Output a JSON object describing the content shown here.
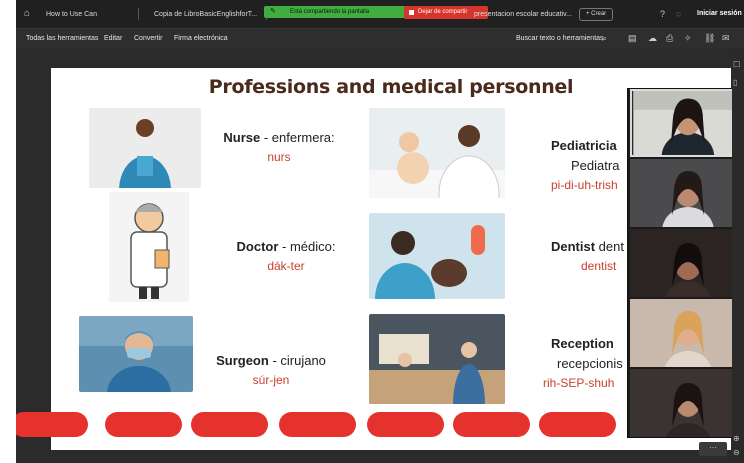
{
  "browser": {
    "tabs": [
      {
        "label": "How to Use Can"
      },
      {
        "label": "Copia de LibroBasicEnglishforT..."
      },
      {
        "label": "presentacion escolar educativ..."
      }
    ],
    "new_tab_label": "+ Crear",
    "sign_in": "Iniciar sesión",
    "share_banner": "Está compartiendo la pantalla",
    "stop_share": "Dejar de compartir"
  },
  "toolbar": {
    "items": [
      "Todas las herramientas",
      "Editar",
      "Convertir",
      "Firma electrónica"
    ],
    "search_label": "Buscar texto o herramientas"
  },
  "slide": {
    "title": "Professions and medical personnel",
    "cards": [
      {
        "term": "Nurse",
        "translation": " - enfermera:",
        "pron": "nurs",
        "picture": "nurse-photo"
      },
      {
        "term": "Doctor",
        "translation": " - médico:",
        "pron": "dák-ter",
        "picture": "doctor-cartoon"
      },
      {
        "term": "Surgeon",
        "translation": " - cirujano",
        "pron": "súr-jen",
        "picture": "surgeon-photo"
      },
      {
        "term": "Pediatricia",
        "translation": "Pediatra",
        "pron": "pi-di-uh-trish",
        "picture": "pediatrician-photo"
      },
      {
        "term": "Dentist",
        "translation": " dent",
        "pron": "dentist",
        "picture": "dentist-photo"
      },
      {
        "term": "Reception",
        "translation": "recepcionis",
        "pron": "rih-SEP-shuh",
        "picture": "reception-photo"
      }
    ],
    "pill_count": 7,
    "accent": "#e5322d",
    "title_color": "#4a2a1a",
    "pron_color": "#c7412f"
  },
  "video_panel": {
    "participants": 5
  },
  "colors": {
    "browser_bg": "#202020",
    "share_green": "#3fae3f",
    "stop_red": "#d6352c"
  }
}
